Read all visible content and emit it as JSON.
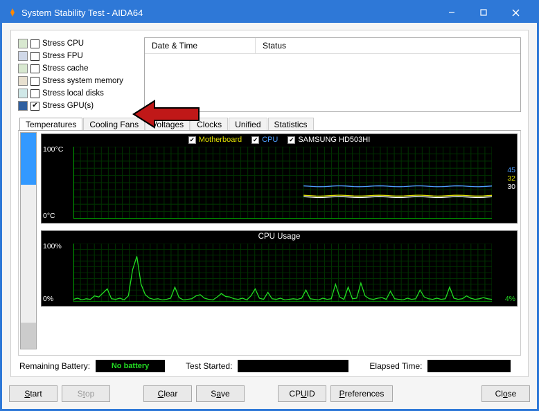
{
  "window": {
    "title": "System Stability Test - AIDA64"
  },
  "stress": {
    "items": [
      {
        "label": "Stress CPU",
        "checked": false,
        "icon": "cpu"
      },
      {
        "label": "Stress FPU",
        "checked": false,
        "icon": "fpu"
      },
      {
        "label": "Stress cache",
        "checked": false,
        "icon": "cpu"
      },
      {
        "label": "Stress system memory",
        "checked": false,
        "icon": "mem"
      },
      {
        "label": "Stress local disks",
        "checked": false,
        "icon": "disk"
      },
      {
        "label": "Stress GPU(s)",
        "checked": true,
        "icon": "gpu"
      }
    ]
  },
  "log": {
    "col_datetime": "Date & Time",
    "col_status": "Status"
  },
  "tabs": {
    "items": [
      "Temperatures",
      "Cooling Fans",
      "Voltages",
      "Clocks",
      "Unified",
      "Statistics"
    ],
    "active": 0
  },
  "chart_data": [
    {
      "type": "line",
      "title": "",
      "series_legend": [
        {
          "name": "Motherboard",
          "color": "#e0e000",
          "checked": true
        },
        {
          "name": "CPU",
          "color": "#4fa0ff",
          "checked": true
        },
        {
          "name": "SAMSUNG HD503HI",
          "color": "#ffffff",
          "checked": true
        }
      ],
      "ylabel_top": "100°C",
      "ylabel_bot": "0°C",
      "ylim": [
        0,
        100
      ],
      "right_values": [
        {
          "v": "45",
          "color": "#4fa0ff"
        },
        {
          "v": "32",
          "color": "#e0e000"
        },
        {
          "v": "30",
          "color": "#ffffff"
        }
      ],
      "series": [
        {
          "name": "CPU",
          "color": "#4fa0ff",
          "flat_value": 45,
          "x_start": 0.55
        },
        {
          "name": "Motherboard",
          "color": "#e0e000",
          "flat_value": 32,
          "x_start": 0.55
        },
        {
          "name": "SAMSUNG HD503HI",
          "color": "#ffffff",
          "flat_value": 30,
          "x_start": 0.55
        }
      ]
    },
    {
      "type": "line",
      "title": "CPU Usage",
      "ylabel_top": "100%",
      "ylabel_bot": "0%",
      "ylim": [
        0,
        100
      ],
      "right_values": [
        {
          "v": "4%",
          "color": "#22dd22"
        }
      ],
      "series": [
        {
          "name": "CPU Usage",
          "color": "#22dd22",
          "values": [
            4,
            6,
            3,
            5,
            4,
            10,
            8,
            15,
            22,
            5,
            4,
            6,
            3,
            10,
            55,
            78,
            30,
            12,
            6,
            4,
            5,
            3,
            4,
            6,
            25,
            7,
            3,
            4,
            5,
            10,
            12,
            6,
            4,
            3,
            8,
            14,
            9,
            8,
            5,
            4,
            6,
            3,
            10,
            22,
            6,
            4,
            16,
            5,
            4,
            6,
            3,
            4,
            5,
            4,
            6,
            20,
            5,
            4,
            3,
            6,
            4,
            5,
            30,
            8,
            4,
            25,
            5,
            6,
            32,
            10,
            5,
            4,
            6,
            7,
            4,
            18,
            5,
            4,
            3,
            6,
            4,
            5,
            20,
            8,
            5,
            4,
            6,
            4,
            5,
            25,
            6,
            4,
            5,
            10,
            6,
            4,
            5,
            7,
            5,
            4
          ]
        }
      ]
    }
  ],
  "status": {
    "battery_label": "Remaining Battery:",
    "battery_value": "No battery",
    "started_label": "Test Started:",
    "started_value": "",
    "elapsed_label": "Elapsed Time:",
    "elapsed_value": ""
  },
  "buttons": {
    "start": "Start",
    "stop": "Stop",
    "clear": "Clear",
    "save": "Save",
    "cpuid": "CPUID",
    "prefs": "Preferences",
    "close": "Close"
  }
}
